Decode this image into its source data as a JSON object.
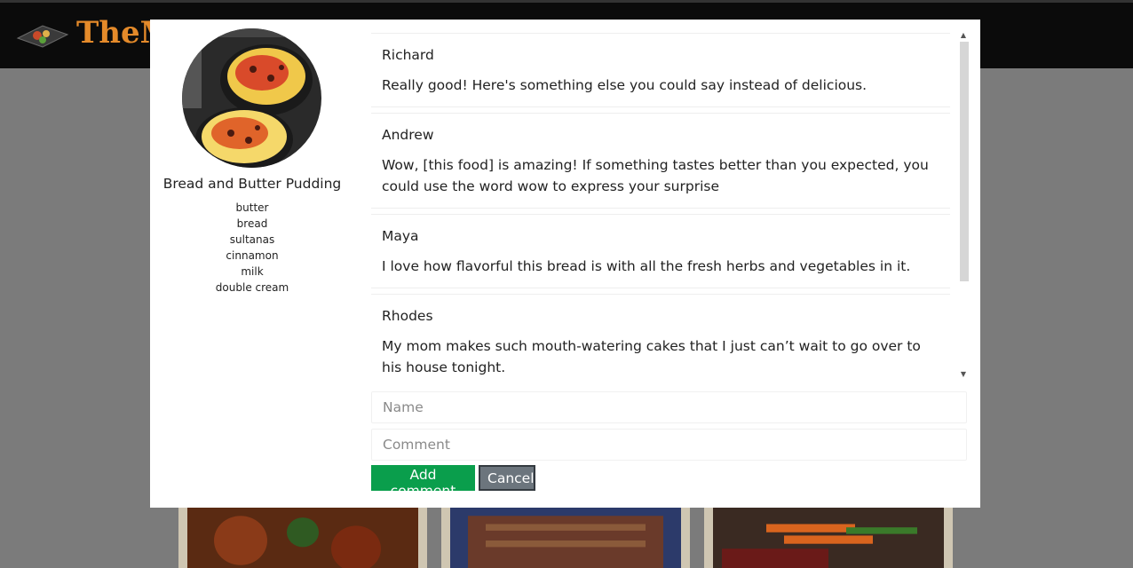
{
  "background": {
    "logo_text": "TheM",
    "colors": {
      "topbar": "#0b0b0b",
      "logo": "#e48a2a",
      "overlay": "#7b7b7b"
    }
  },
  "modal": {
    "recipe": {
      "title": "Bread and Butter Pudding",
      "ingredients": [
        "butter",
        "bread",
        "sultanas",
        "cinnamon",
        "milk",
        "double cream"
      ]
    },
    "comments": [
      {
        "author": "Richard",
        "text": "Really good! Here's something else you could say instead of delicious."
      },
      {
        "author": "Andrew",
        "text": "Wow, [this food] is amazing! If something tastes better than you expected, you could use the word wow to express your surprise"
      },
      {
        "author": "Maya",
        "text": "I love how flavorful this bread is with all the fresh herbs and vegetables in it."
      },
      {
        "author": "Rhodes",
        "text": "My mom makes such mouth-watering cakes that I just can’t wait to go over to his house tonight."
      }
    ],
    "form": {
      "name_placeholder": "Name",
      "comment_placeholder": "Comment",
      "add_label": "Add comment",
      "cancel_label": "Cancel"
    },
    "colors": {
      "add_button": "#0a9e4c",
      "cancel_button": "#6c757d"
    }
  }
}
